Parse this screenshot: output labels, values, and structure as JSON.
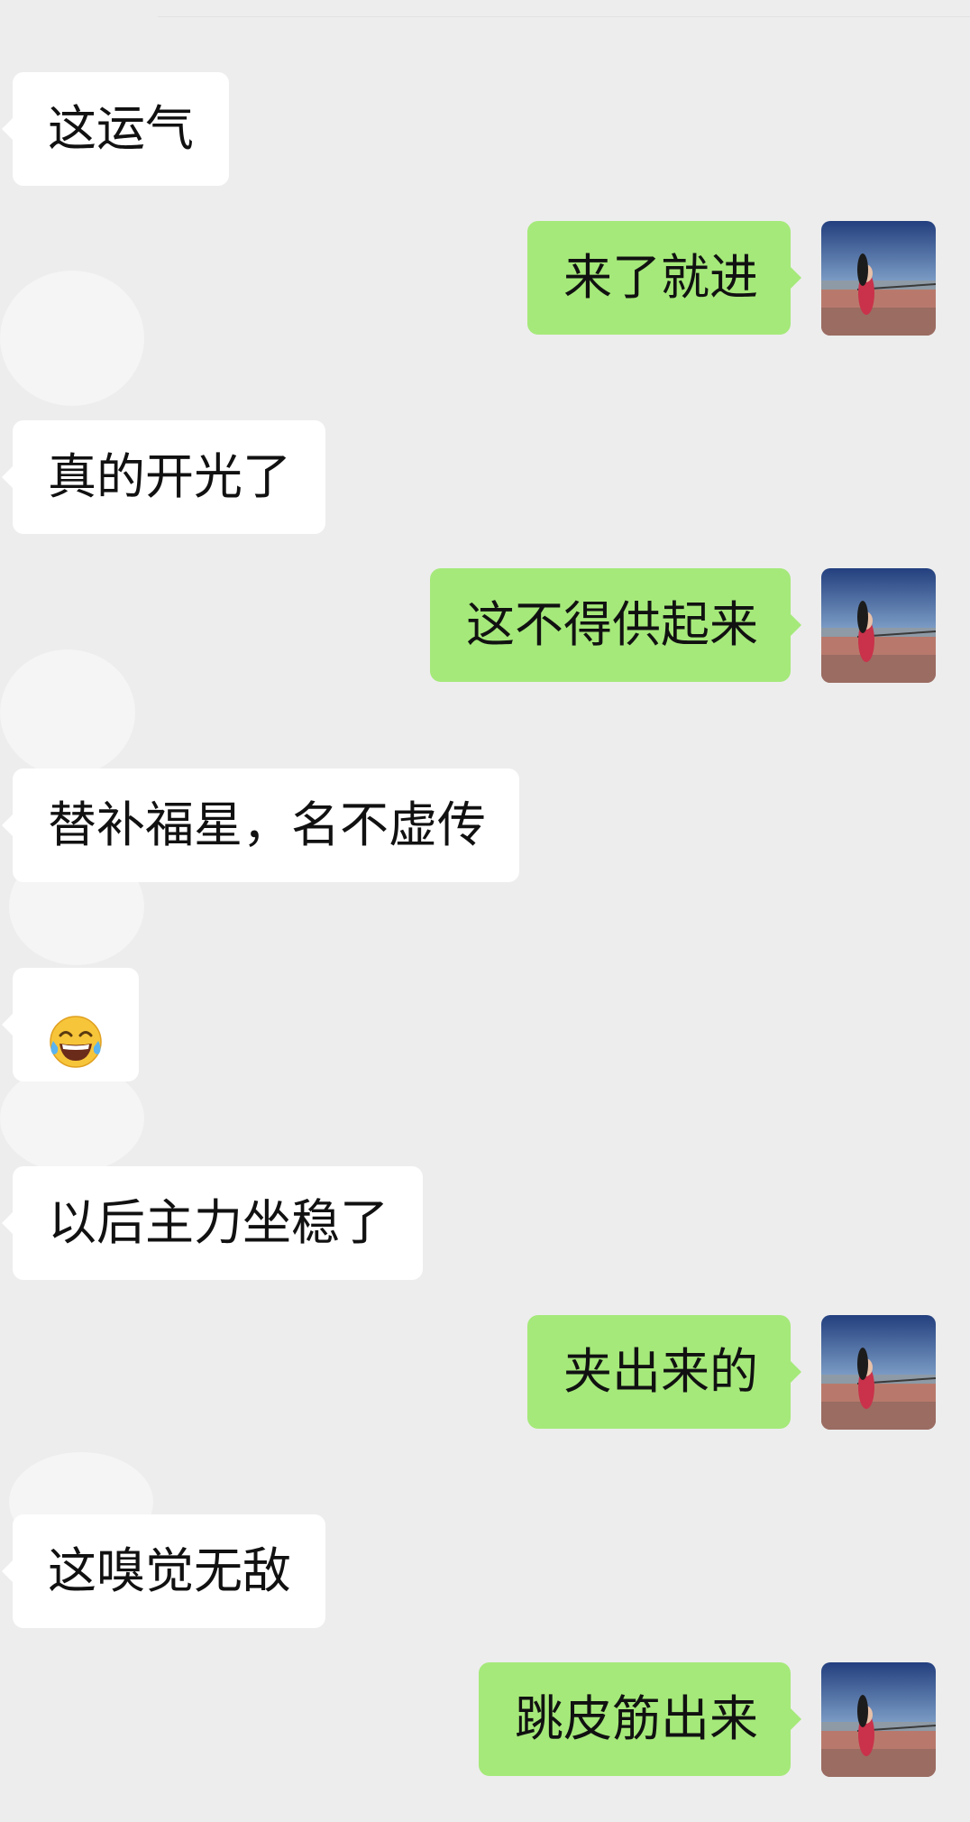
{
  "messages": [
    {
      "side": "in",
      "text": "这运气"
    },
    {
      "side": "out",
      "text": "来了就进"
    },
    {
      "side": "in",
      "text": "真的开光了"
    },
    {
      "side": "out",
      "text": "这不得供起来"
    },
    {
      "side": "in",
      "text": "替补福星，名不虚传"
    },
    {
      "side": "in",
      "emoji": "tears-of-joy-emoji"
    },
    {
      "side": "in",
      "text": "以后主力坐稳了"
    },
    {
      "side": "out",
      "text": "夹出来的"
    },
    {
      "side": "in",
      "text": "这嗅觉无敌"
    },
    {
      "side": "out",
      "text": "跳皮筋出来"
    }
  ],
  "colors": {
    "background": "#ededed",
    "incoming_bubble": "#ffffff",
    "outgoing_bubble": "#a5e97a",
    "text": "#111111"
  },
  "icons": {
    "self_avatar": "avatar-photo-woman-by-river",
    "emoji": "tears-of-joy-emoji"
  }
}
